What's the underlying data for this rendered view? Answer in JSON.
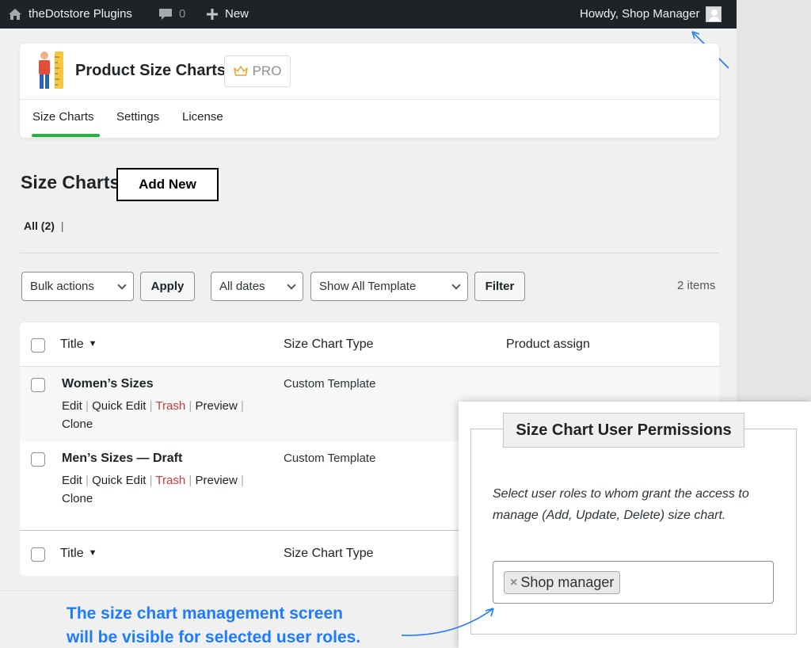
{
  "admin_bar": {
    "site_name": "theDotstore Plugins",
    "comments_count": "0",
    "new_label": "New",
    "greeting": "Howdy, Shop Manager"
  },
  "plugin": {
    "name": "Product Size Charts",
    "pro_label": "PRO",
    "tabs": [
      {
        "label": "Size Charts",
        "active": true
      },
      {
        "label": "Settings",
        "active": false
      },
      {
        "label": "License",
        "active": false
      }
    ]
  },
  "page": {
    "title": "Size Charts",
    "add_new": "Add New",
    "filter_all": "All",
    "filter_all_count": "(2)",
    "filter_sep": "|"
  },
  "tablenav": {
    "bulk_actions": "Bulk actions",
    "apply": "Apply",
    "dates": "All dates",
    "template": "Show All Template",
    "filter": "Filter",
    "items": "2 items"
  },
  "table": {
    "columns": {
      "title": "Title",
      "type": "Size Chart Type",
      "assign": "Product assign"
    },
    "rows": [
      {
        "title": "Women’s Sizes",
        "type": "Custom Template"
      },
      {
        "title": "Men’s Sizes — Draft",
        "type": "Custom Template"
      }
    ],
    "row_actions": {
      "edit": "Edit",
      "quick_edit": "Quick Edit",
      "trash": "Trash",
      "preview": "Preview",
      "clone": "Clone",
      "sep": "|"
    }
  },
  "permissions": {
    "legend": "Size Chart User Permissions",
    "description": "Select user roles to whom grant the access to manage (Add, Update, Delete) size chart.",
    "selected_role": "Shop manager",
    "remove_glyph": "×"
  },
  "annotation": {
    "line1": "The size chart management screen",
    "line2": "will be visible for selected user roles."
  },
  "colors": {
    "admin_bar": "#1d2327",
    "active_tab": "#1eb63c",
    "trash": "#d63638",
    "annotation": "#1e7bff"
  }
}
